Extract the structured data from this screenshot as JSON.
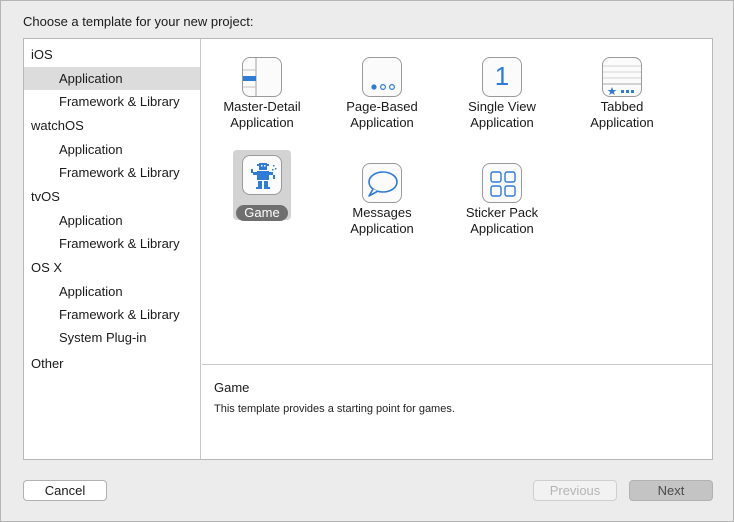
{
  "dialog": {
    "header": "Choose a template for your new project:"
  },
  "sidebar": {
    "items": [
      {
        "label": "iOS"
      },
      {
        "label": "Application"
      },
      {
        "label": "Framework & Library"
      },
      {
        "label": "watchOS"
      },
      {
        "label": "Application"
      },
      {
        "label": "Framework & Library"
      },
      {
        "label": "tvOS"
      },
      {
        "label": "Application"
      },
      {
        "label": "Framework & Library"
      },
      {
        "label": "OS X"
      },
      {
        "label": "Application"
      },
      {
        "label": "Framework & Library"
      },
      {
        "label": "System Plug-in"
      },
      {
        "label": "Other"
      }
    ]
  },
  "templates": [
    {
      "label": "Master-Detail\nApplication",
      "icon": "master-detail-icon"
    },
    {
      "label": "Page-Based\nApplication",
      "icon": "page-based-icon"
    },
    {
      "label": "Single View\nApplication",
      "icon": "single-view-icon",
      "glyph": "1"
    },
    {
      "label": "Tabbed\nApplication",
      "icon": "tabbed-icon"
    },
    {
      "label": "Game",
      "icon": "game-icon"
    },
    {
      "label": "Messages\nApplication",
      "icon": "messages-icon"
    },
    {
      "label": "Sticker Pack\nApplication",
      "icon": "sticker-pack-icon"
    }
  ],
  "detail": {
    "title": "Game",
    "description": "This template provides a starting point for games."
  },
  "buttons": {
    "cancel": "Cancel",
    "previous": "Previous",
    "next": "Next"
  },
  "colors": {
    "accent": "#2f7bd8",
    "selection": "#dcdcdc",
    "pill": "#6f6f6f"
  }
}
